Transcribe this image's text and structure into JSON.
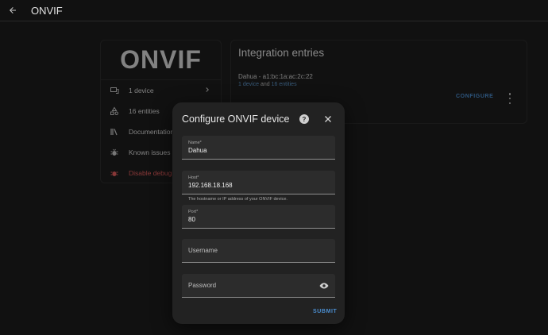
{
  "header": {
    "title": "ONVIF",
    "back_icon": "arrow-left-icon"
  },
  "info_card": {
    "logo": "ONVIF",
    "items": [
      {
        "label": "1 device",
        "icon": "device-icon"
      },
      {
        "label": "16 entities",
        "icon": "shapes-icon"
      },
      {
        "label": "Documentation",
        "icon": "book-icon"
      },
      {
        "label": "Known issues",
        "icon": "bug-icon"
      },
      {
        "label": "Disable debug lo",
        "icon": "debug-icon"
      }
    ]
  },
  "entries": {
    "title": "Integration entries",
    "entry_name": "Dahua - a1:bc:1a:ac:2c:22",
    "devices_link": "1 device",
    "and_text": " and ",
    "entities_link": "16 entities",
    "configure_label": "CONFIGURE"
  },
  "dialog": {
    "title": "Configure ONVIF device",
    "fields": {
      "name": {
        "label": "Name*",
        "value": "Dahua"
      },
      "host": {
        "label": "Host*",
        "value": "192.168.18.168",
        "helper": "The hostname or IP address of your ONVIF device."
      },
      "port": {
        "label": "Port*",
        "value": "80"
      },
      "username": {
        "placeholder": "Username"
      },
      "password": {
        "placeholder": "Password"
      }
    },
    "submit_label": "SUBMIT"
  },
  "colors": {
    "accent": "#4b8ed0",
    "danger": "#e25c5c",
    "background": "#111111"
  }
}
